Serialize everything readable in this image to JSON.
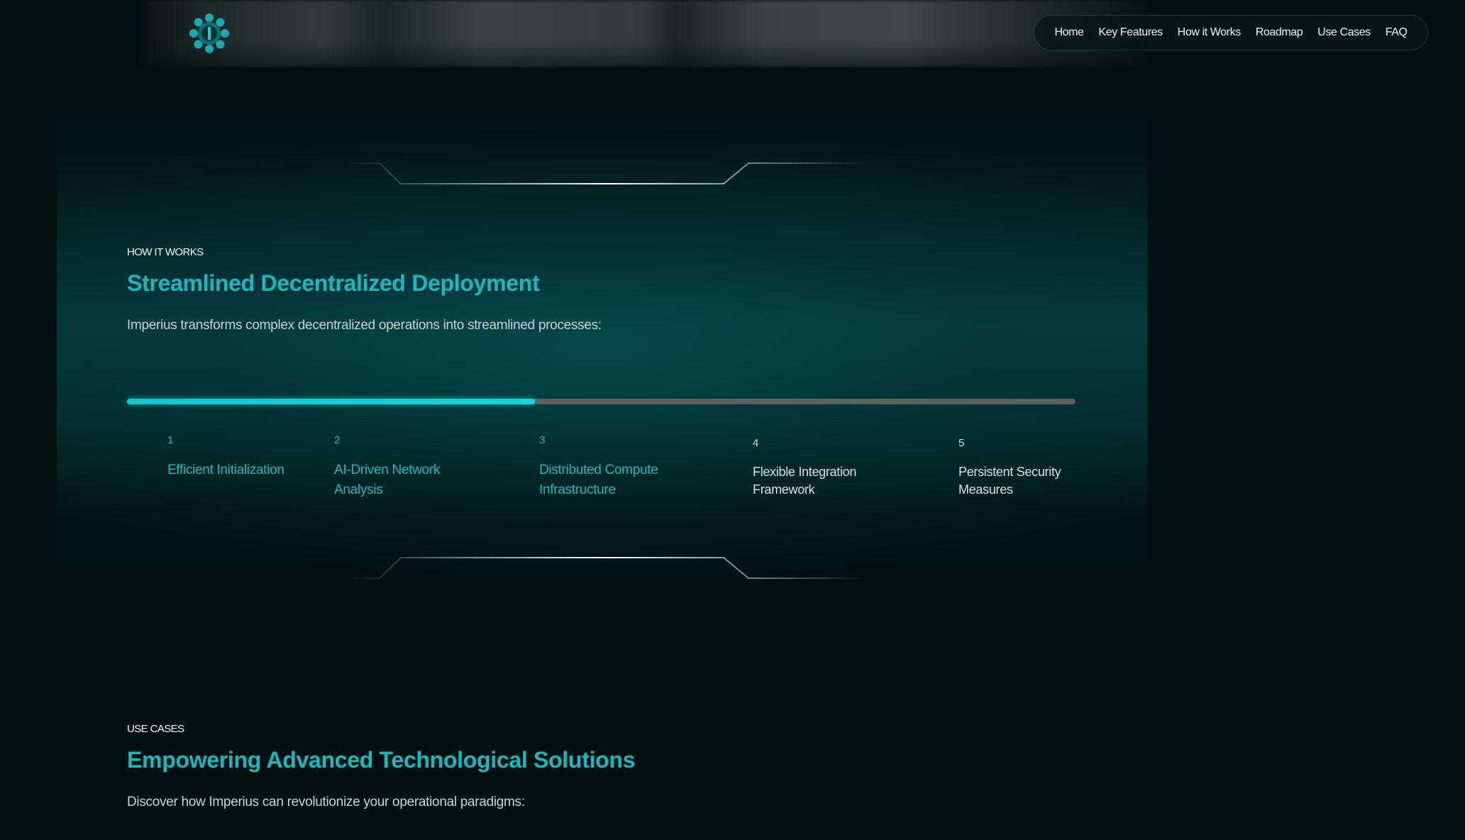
{
  "nav": {
    "items": [
      "Home",
      "Key Features",
      "How it Works",
      "Roadmap",
      "Use Cases",
      "FAQ"
    ]
  },
  "logo": {
    "icon": "gear-flower-logo-icon",
    "color": "#16b9bd"
  },
  "how_it_works": {
    "eyebrow": "HOW IT WORKS",
    "title": "Streamlined Decentralized Deployment",
    "description": "Imperius transforms complex decentralized operations into streamlined processes:",
    "progress_fraction": 0.43,
    "steps": [
      {
        "number": "1",
        "label": "Efficient Initialization",
        "state": "active"
      },
      {
        "number": "2",
        "label": "AI-Driven Network Analysis",
        "state": "active"
      },
      {
        "number": "3",
        "label": "Distributed Compute Infrastructure",
        "state": "active"
      },
      {
        "number": "4",
        "label": "Flexible Integration Framework",
        "state": "pending"
      },
      {
        "number": "5",
        "label": "Persistent Security Measures",
        "state": "pending"
      }
    ]
  },
  "use_cases": {
    "eyebrow": "USE CASES",
    "title": "Empowering Advanced Technological Solutions",
    "description": "Discover how Imperius can revolutionize your operational paradigms:"
  },
  "colors": {
    "accent": "#16b9bd",
    "background": "#031012",
    "track": "#5a6161"
  }
}
